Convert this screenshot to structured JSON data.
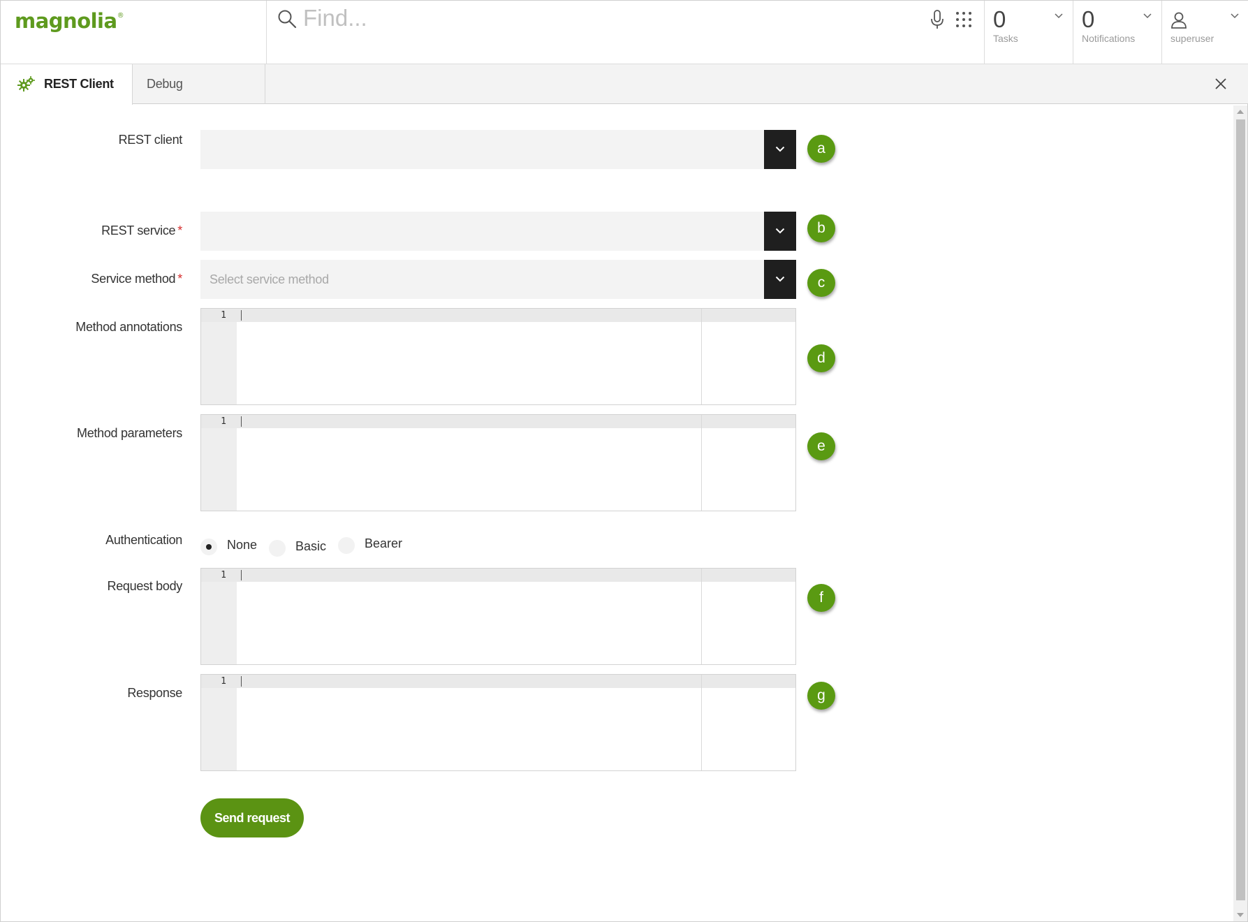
{
  "header": {
    "logo_text": "magnolia",
    "logo_mark": "®",
    "search_placeholder": "Find...",
    "tasks": {
      "count": "0",
      "label": "Tasks"
    },
    "notifications": {
      "count": "0",
      "label": "Notifications"
    },
    "user": {
      "label": "superuser"
    }
  },
  "tabs": [
    {
      "label": "REST Client",
      "active": true,
      "icon": "gears-icon"
    },
    {
      "label": "Debug",
      "active": false
    }
  ],
  "form": {
    "rest_client": {
      "label": "REST client",
      "value": "",
      "badge": "a"
    },
    "rest_service": {
      "label": "REST service",
      "required_mark": "*",
      "value": "",
      "badge": "b"
    },
    "service_method": {
      "label": "Service method",
      "required_mark": "*",
      "placeholder": "Select service method",
      "badge": "c"
    },
    "method_annotations": {
      "label": "Method annotations",
      "line_number": "1",
      "badge": "d"
    },
    "method_parameters": {
      "label": "Method parameters",
      "line_number": "1",
      "badge": "e"
    },
    "authentication": {
      "label": "Authentication",
      "options": [
        "None",
        "Basic",
        "Bearer"
      ],
      "selected": "None"
    },
    "request_body": {
      "label": "Request body",
      "line_number": "1",
      "badge": "f"
    },
    "response": {
      "label": "Response",
      "line_number": "1",
      "badge": "g"
    },
    "send_button": "Send request"
  },
  "colors": {
    "brand_green": "#5e9a1e",
    "badge_green": "#5a9a12",
    "button_green": "#5b9313",
    "select_arrow_bg": "#1f1f1f",
    "required_red": "#d62d2d"
  }
}
